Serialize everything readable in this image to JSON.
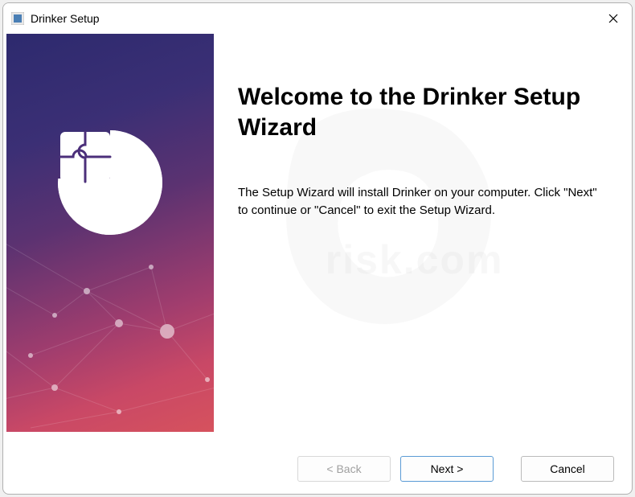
{
  "titlebar": {
    "title": "Drinker Setup"
  },
  "main": {
    "heading": "Welcome to the Drinker Setup Wizard",
    "body": "The Setup Wizard will install Drinker on your computer.  Click \"Next\" to continue or \"Cancel\" to exit the Setup Wizard."
  },
  "buttons": {
    "back": "< Back",
    "next": "Next >",
    "cancel": "Cancel"
  }
}
